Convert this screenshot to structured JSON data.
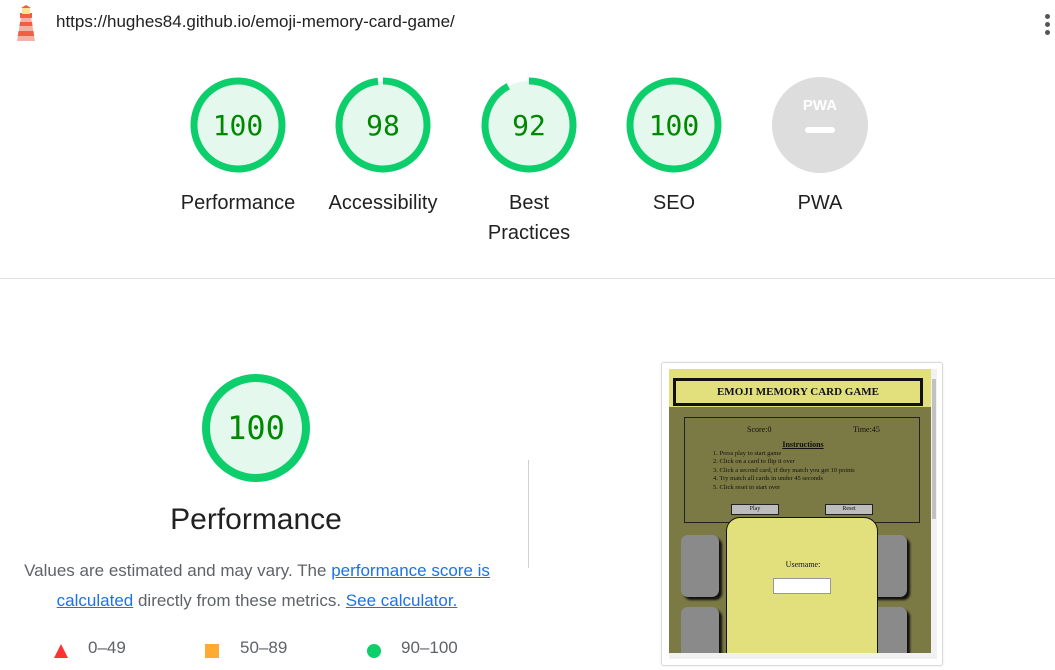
{
  "toolbar": {
    "url": "https://hughes84.github.io/emoji-memory-card-game/",
    "logo_icon": "lighthouse-icon",
    "menu_icon": "more-vert-icon"
  },
  "gauges": [
    {
      "label": "Performance",
      "score": "100",
      "value": 100
    },
    {
      "label": "Accessibility",
      "score": "98",
      "value": 98
    },
    {
      "label": "Best Practices",
      "score": "92",
      "value": 92
    },
    {
      "label": "SEO",
      "score": "100",
      "value": 100
    },
    {
      "label": "PWA",
      "badge": "PWA",
      "value": null
    }
  ],
  "performance": {
    "score": "100",
    "title": "Performance",
    "desc_prefix": "Values are estimated and may vary. The ",
    "link_score": "performance score is calculated",
    "desc_mid": " directly from these metrics. ",
    "link_calc": "See calculator."
  },
  "legend": [
    {
      "range": "0–49",
      "shape": "triangle",
      "color": "#ff3333"
    },
    {
      "range": "50–89",
      "shape": "square",
      "color": "#ffaa33"
    },
    {
      "range": "90–100",
      "shape": "circle",
      "color": "#0cce6b"
    }
  ],
  "colors": {
    "pass": "#0cce6b",
    "pass_fill": "#e5f8ee",
    "pass_text": "#008800",
    "neutral": "#dddddd"
  },
  "screenshot": {
    "title": "EMOJI MEMORY CARD GAME",
    "score": "Score:0",
    "time": "Time:45",
    "instructions_heading": "Instructions",
    "instructions": [
      "1. Press play to start game",
      "2. Click on a card to flip it over",
      "3. Click a second card, if they match you get 10 points",
      "4. Try match all cards in under 45 seconds",
      "5. Click reset to start over"
    ],
    "play": "Play",
    "reset": "Reset",
    "username_label": "Username:"
  }
}
